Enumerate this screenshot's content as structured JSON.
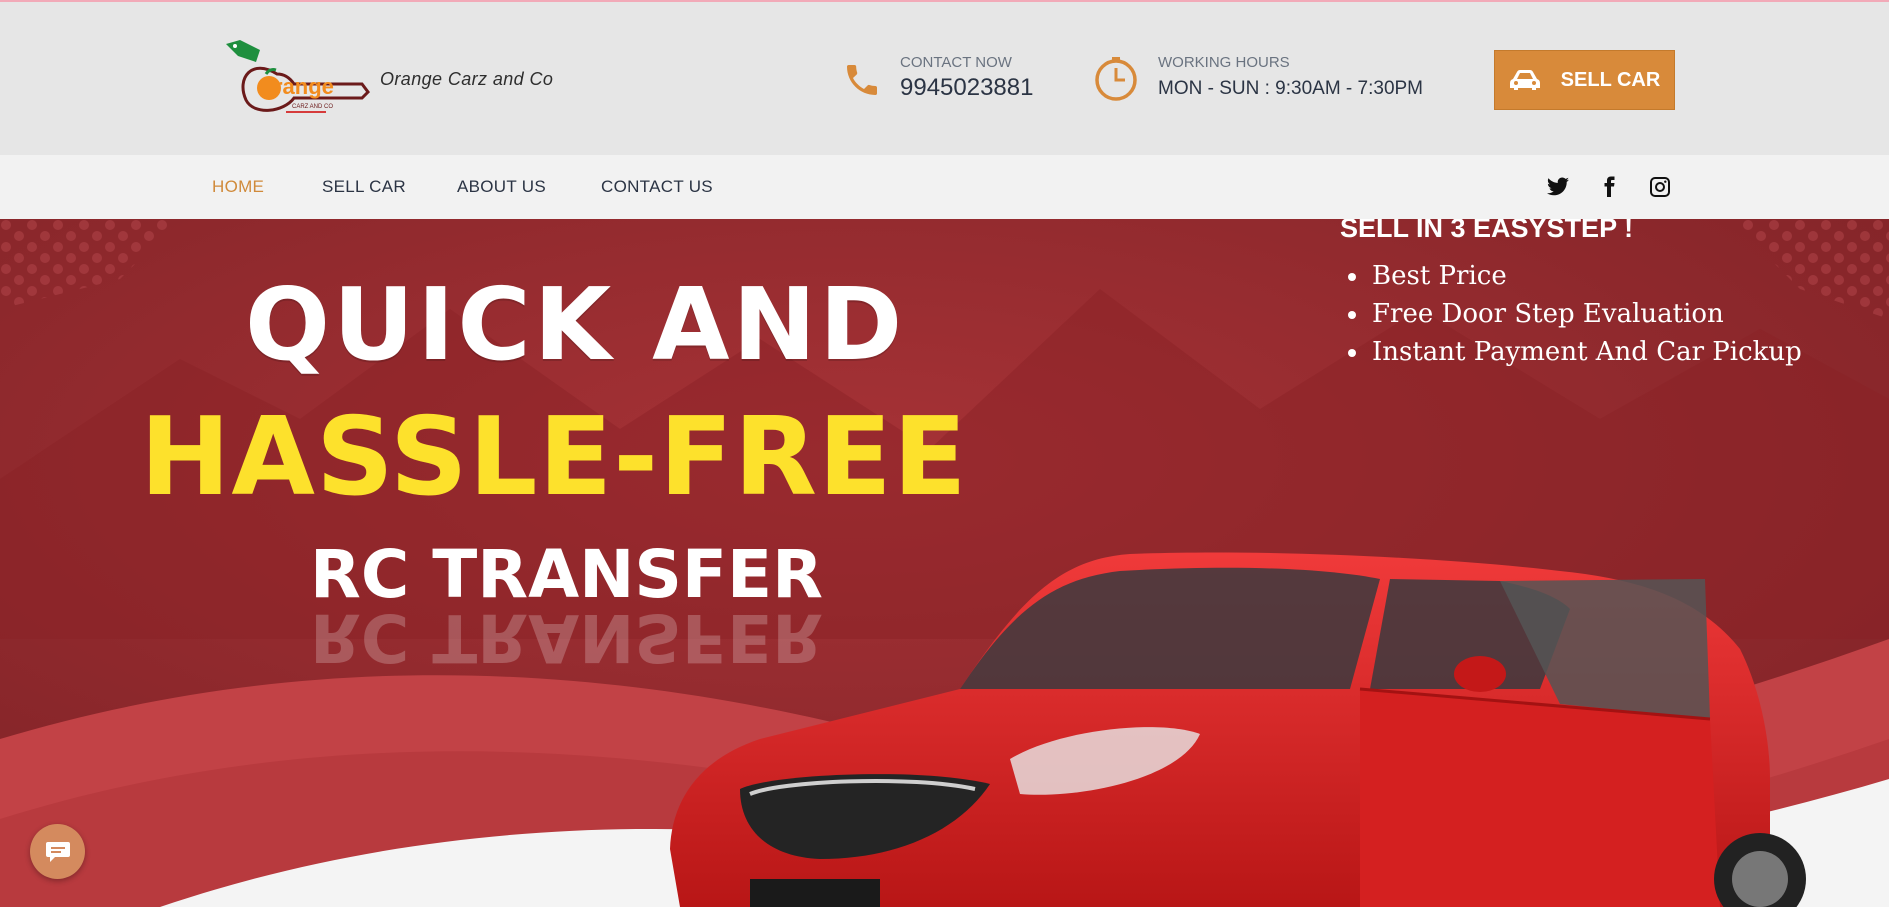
{
  "header": {
    "brand_name": "Orange Carz and Co",
    "logo_alt": "Orange Carz and Co logo",
    "logo_text": "range",
    "logo_sub": "CARZ AND CO",
    "contact": {
      "label": "CONTACT NOW",
      "value": "9945023881",
      "icon": "phone-icon"
    },
    "hours": {
      "label": "WORKING HOURS",
      "value": "MON - SUN : 9:30AM - 7:30PM",
      "icon": "clock-icon"
    },
    "cta": {
      "label": "SELL CAR",
      "icon": "car-icon"
    }
  },
  "nav": {
    "items": [
      {
        "label": "HOME",
        "active": true
      },
      {
        "label": "SELL CAR",
        "active": false
      },
      {
        "label": "ABOUT US",
        "active": false
      },
      {
        "label": "CONTACT US",
        "active": false
      }
    ],
    "social": [
      "twitter-icon",
      "facebook-icon",
      "instagram-icon"
    ]
  },
  "hero": {
    "line1": "QUICK AND",
    "line2": "HASSLE-FREE",
    "line3": "RC TRANSFER",
    "steps_title": "SELL IN 3 EASYSTEP !",
    "steps": [
      "Best Price",
      "Free Door Step Evaluation",
      "Instant Payment And Car Pickup"
    ]
  },
  "chat": {
    "icon": "chat-icon"
  },
  "colors": {
    "accent": "#d88a3a",
    "hero_red": "#8e2a2e",
    "headline_yellow": "#fde12c",
    "nav_text": "#2b3444"
  }
}
